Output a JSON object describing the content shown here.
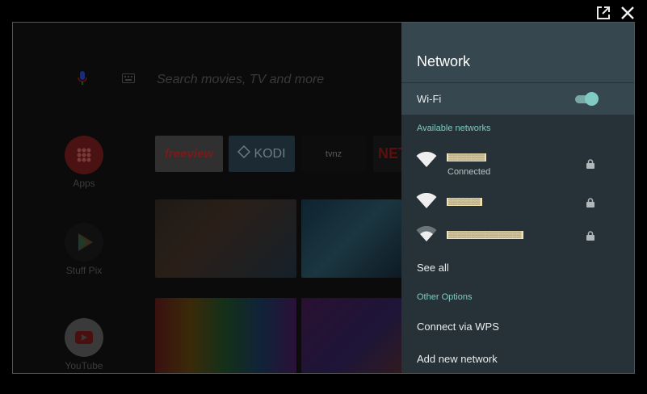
{
  "window": {
    "open_external_icon": "open-in-new-icon",
    "close_icon": "close-icon"
  },
  "launcher": {
    "search_placeholder": "Search movies, TV and more",
    "apps": [
      {
        "label": "Apps",
        "icon": "apps-grid-icon",
        "color": "#c62828"
      },
      {
        "label": "Stuff Pix",
        "icon": "play-store-icon",
        "color": "#1b1b1b"
      },
      {
        "label": "YouTube",
        "icon": "youtube-icon",
        "color": "#e53935"
      }
    ],
    "tiles": {
      "freeview": "freeview",
      "kodi": "KODI",
      "tvnz": "tvnz",
      "netflix": "NET"
    }
  },
  "network_panel": {
    "title": "Network",
    "wifi_label": "Wi-Fi",
    "wifi_enabled": true,
    "available_header": "Available networks",
    "networks": [
      {
        "ssid": "▒▒▒▒▒▒▒▒",
        "status": "Connected",
        "locked": true
      },
      {
        "ssid": "▒▒▒▒▒▒▒",
        "status": "",
        "locked": true
      },
      {
        "ssid": "▒▒▒▒▒▒▒▒▒▒▒▒▒▒▒▒",
        "status": "",
        "locked": true
      }
    ],
    "see_all": "See all",
    "other_header": "Other Options",
    "wps": "Connect via WPS",
    "add_network": "Add new network"
  },
  "colors": {
    "panel_bg": "#263238",
    "panel_header": "#37474f",
    "accent": "#80cbc4"
  }
}
